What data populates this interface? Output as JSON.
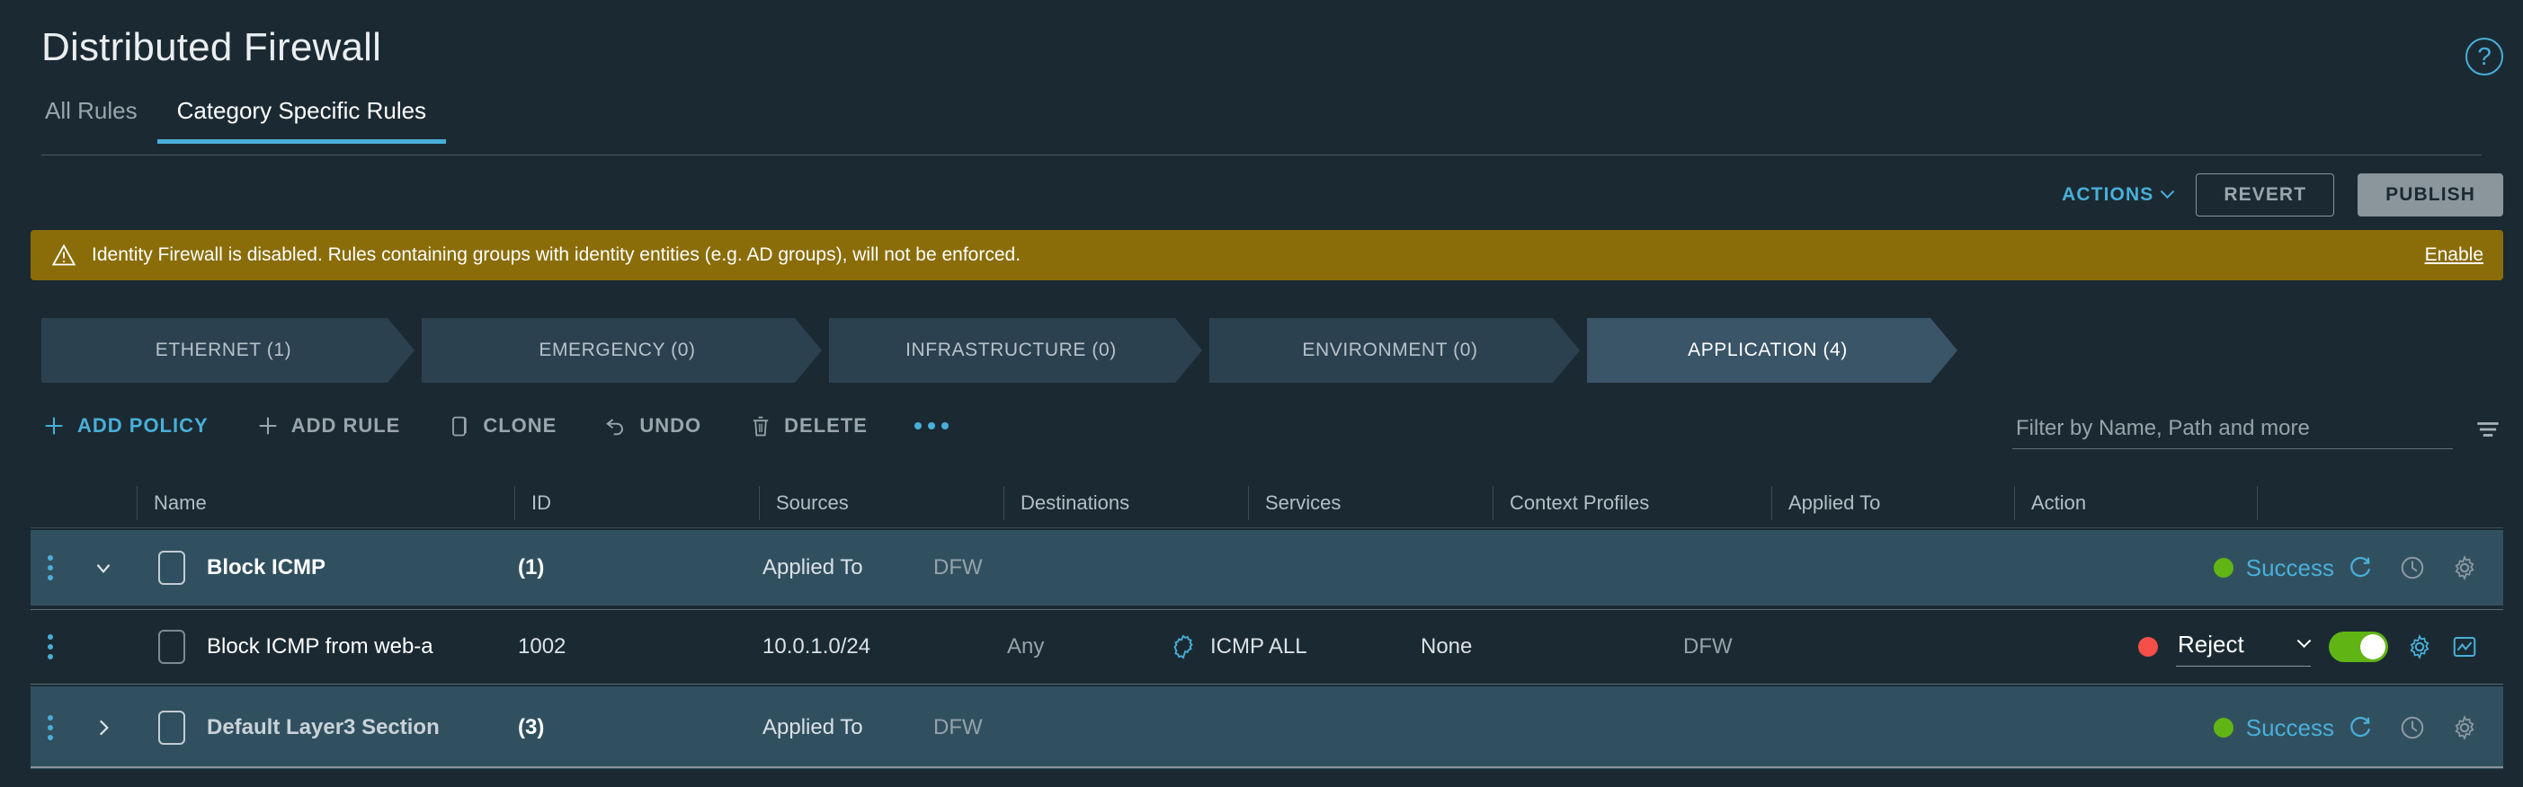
{
  "header": {
    "title": "Distributed Firewall",
    "help_icon": "help-circle-icon"
  },
  "tabs": [
    {
      "label": "All Rules",
      "active": false
    },
    {
      "label": "Category Specific Rules",
      "active": true
    }
  ],
  "actionbar": {
    "actions_label": "ACTIONS",
    "revert_label": "REVERT",
    "publish_label": "PUBLISH"
  },
  "banner": {
    "icon": "warning-triangle-icon",
    "text": "Identity Firewall is disabled. Rules containing groups with identity entities (e.g. AD groups), will not be enforced.",
    "link_label": "Enable",
    "color": "#8a6d08"
  },
  "categories": [
    {
      "label": "ETHERNET (1)",
      "active": false
    },
    {
      "label": "EMERGENCY (0)",
      "active": false
    },
    {
      "label": "INFRASTRUCTURE (0)",
      "active": false
    },
    {
      "label": "ENVIRONMENT (0)",
      "active": false
    },
    {
      "label": "APPLICATION (4)",
      "active": true
    }
  ],
  "toolbar": [
    {
      "label": "ADD POLICY",
      "icon": "plus-icon",
      "primary": true
    },
    {
      "label": "ADD RULE",
      "icon": "plus-icon",
      "primary": false
    },
    {
      "label": "CLONE",
      "icon": "clone-icon",
      "primary": false
    },
    {
      "label": "UNDO",
      "icon": "undo-icon",
      "primary": false
    },
    {
      "label": "DELETE",
      "icon": "trash-icon",
      "primary": false
    }
  ],
  "toolbar_more_icon": "more-horizontal-icon",
  "filter": {
    "placeholder": "Filter by Name, Path and more",
    "value": "",
    "icon": "filter-icon"
  },
  "table": {
    "columns": [
      "Name",
      "ID",
      "Sources",
      "Destinations",
      "Services",
      "Context Profiles",
      "Applied To",
      "Action"
    ],
    "rows": [
      {
        "type": "policy",
        "expanded": true,
        "caret_icon": "chevron-down-icon",
        "name": "Block ICMP",
        "id": "(1)",
        "applied_to_label": "Applied To",
        "applied_to_value": "DFW",
        "status_text": "Success",
        "status_color": "#60b515",
        "icons": [
          "refresh-icon",
          "clock-icon",
          "gear-icon"
        ]
      },
      {
        "type": "rule",
        "name": "Block ICMP from web-a",
        "id": "1002",
        "sources": "10.0.1.0/24",
        "destinations": "Any",
        "services": "ICMP ALL",
        "services_icon": "service-burst-icon",
        "context_profiles": "None",
        "applied_to": "DFW",
        "action": "Reject",
        "action_dot_color": "#f54f47",
        "toggle_on": true,
        "toggle_color": "#60b515",
        "icons": [
          "gear-icon",
          "stats-icon"
        ]
      },
      {
        "type": "policy",
        "expanded": false,
        "caret_icon": "chevron-right-icon",
        "name": "Default Layer3 Section",
        "id": "(3)",
        "applied_to_label": "Applied To",
        "applied_to_value": "DFW",
        "status_text": "Success",
        "status_color": "#60b515",
        "icons": [
          "refresh-icon",
          "clock-icon",
          "gear-icon"
        ]
      }
    ]
  }
}
